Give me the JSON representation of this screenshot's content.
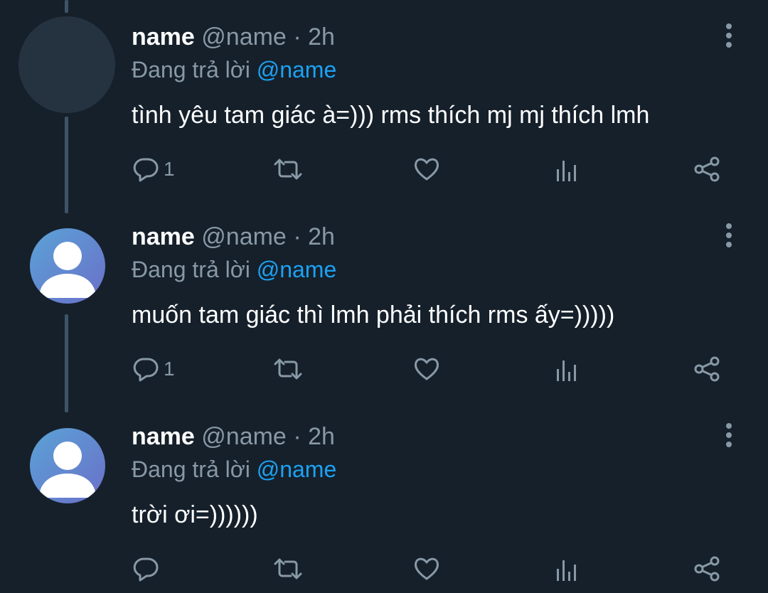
{
  "colors": {
    "background": "#15202b",
    "secondary_text": "#8899a6",
    "accent": "#1da1f2",
    "thread_line": "#3d5466"
  },
  "tweets": [
    {
      "name": "name",
      "handle": "@name",
      "separator": "·",
      "time": "2h",
      "replying_prefix": "Đang trả lời",
      "replying_to": "@name",
      "text": "tình yêu tam giác à=))) rms thích mj mj thích lmh",
      "reply_count": "1",
      "avatar": "default-avatar-blank"
    },
    {
      "name": "name",
      "handle": "@name",
      "separator": "·",
      "time": "2h",
      "replying_prefix": "Đang trả lời",
      "replying_to": "@name",
      "text": "muốn tam giác thì lmh phải thích rms ấy=)))))",
      "reply_count": "1",
      "avatar": "default-avatar-person"
    },
    {
      "name": "name",
      "handle": "@name",
      "separator": "·",
      "time": "2h",
      "replying_prefix": "Đang trả lời",
      "replying_to": "@name",
      "text": "trời ơi=))))))",
      "reply_count": "",
      "avatar": "default-avatar-person"
    }
  ],
  "icons": [
    "reply-icon",
    "retweet-icon",
    "like-icon",
    "analytics-icon",
    "share-icon",
    "more-options-icon"
  ]
}
